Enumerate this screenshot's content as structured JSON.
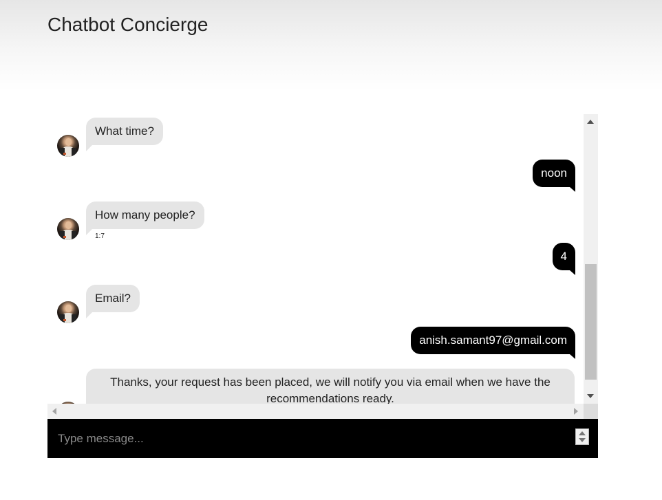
{
  "header": {
    "title": "Chatbot Concierge"
  },
  "chat": {
    "messages": [
      {
        "sender": "bot",
        "text": "What time?"
      },
      {
        "sender": "user",
        "text": "noon"
      },
      {
        "sender": "bot",
        "text": "How many people?",
        "timestamp": "1:7"
      },
      {
        "sender": "user",
        "text": "4"
      },
      {
        "sender": "bot",
        "text": "Email?"
      },
      {
        "sender": "user",
        "text": "anish.samant97@gmail.com"
      },
      {
        "sender": "bot",
        "text": "Thanks, your request has been placed, we will notify you via email when we have the recommendations ready."
      }
    ]
  },
  "composer": {
    "placeholder": "Type message...",
    "value": ""
  },
  "colors": {
    "bot_bubble": "#e5e5e5",
    "user_bubble": "#000000",
    "input_bar": "#000000"
  },
  "icons": {
    "avatar": "bot-avatar",
    "scroll_up": "scroll-up-arrow-icon",
    "scroll_down": "scroll-down-arrow-icon",
    "scroll_left": "scroll-left-arrow-icon",
    "scroll_right": "scroll-right-arrow-icon",
    "spinner": "number-spinner-icon"
  }
}
